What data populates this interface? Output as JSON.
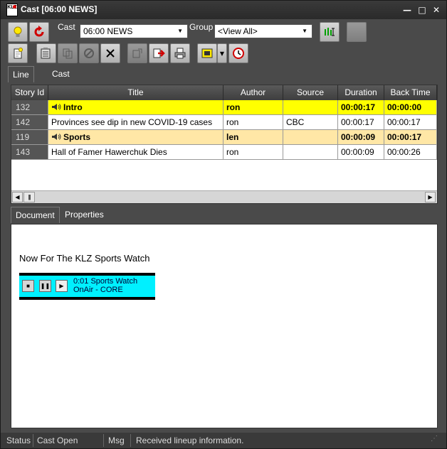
{
  "window": {
    "title": "Cast [06:00 NEWS]",
    "logo_text": "KLZ",
    "minimize_glyph": "—",
    "maximize_glyph": "□",
    "close_glyph": "✕"
  },
  "toolbar": {
    "cast_label": "Cast",
    "cast_value": "06:00 NEWS",
    "group_label": "Group",
    "group_value": "<View All>",
    "icons_row1": [
      "lightbulb-icon",
      "refresh-red-icon",
      "green-tuner-icon",
      "blank-button"
    ],
    "icons_row2": [
      "new-story-icon",
      "paste-list-icon",
      "copy-disabled-icon",
      "no-entry-disabled-icon",
      "delete-x-icon",
      "paste-disabled-icon",
      "export-red-arrow-icon",
      "print-icon",
      "film-icon",
      "dropdown-arrow",
      "clock-icon"
    ]
  },
  "tabs_top": [
    {
      "label": "Line Up",
      "active": true
    },
    {
      "label": "Cast Stats",
      "active": false
    }
  ],
  "grid": {
    "columns": [
      "Story Id",
      "Title",
      "Author",
      "Source",
      "Duration",
      "Back Time"
    ],
    "rows": [
      {
        "id": "132",
        "title": "Intro",
        "author": "ron",
        "source": "",
        "duration": "00:00:17",
        "back_time": "00:00:00",
        "style": "yellow",
        "audio": true
      },
      {
        "id": "142",
        "title": "Provinces see dip in new COVID-19 cases",
        "author": "ron",
        "source": "CBC",
        "duration": "00:00:17",
        "back_time": "00:00:17",
        "style": "white",
        "audio": false
      },
      {
        "id": "119",
        "title": "Sports",
        "author": "len",
        "source": "",
        "duration": "00:00:09",
        "back_time": "00:00:17",
        "style": "orange",
        "audio": true
      },
      {
        "id": "143",
        "title": "Hall of Famer Hawerchuk Dies",
        "author": "ron",
        "source": "",
        "duration": "00:00:09",
        "back_time": "00:00:26",
        "style": "white",
        "audio": false
      }
    ],
    "row_colors": {
      "yellow": "#ffff00",
      "orange": "#ffe7a6",
      "white": "#ffffff"
    }
  },
  "tabs_bottom": [
    {
      "label": "Document",
      "active": true
    },
    {
      "label": "Properties",
      "active": false
    }
  ],
  "document": {
    "text": "Now For The KLZ Sports Watch",
    "media": {
      "line1": "0:01 Sports Watch",
      "line2": "OnAir - CORE",
      "bg_color": "#00f0ff"
    }
  },
  "statusbar": {
    "status_label": "Status",
    "status_value": "Cast Open",
    "msg_label": "Msg",
    "msg_value": "Received lineup information."
  }
}
